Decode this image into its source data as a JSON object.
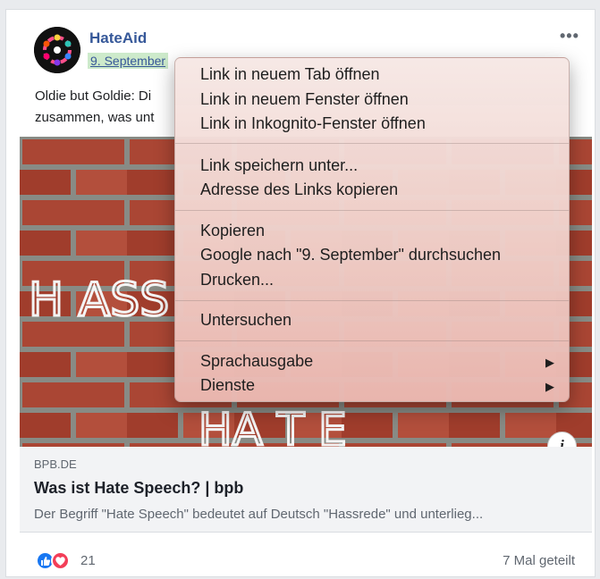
{
  "post": {
    "page_name": "HateAid",
    "date": "9. September",
    "text_line1": "Oldie but Goldie: Di",
    "text_line2": "zusammen, was unt",
    "more_label": "•••"
  },
  "link_preview": {
    "domain": "BPB.DE",
    "title": "Was ist Hate Speech? | bpb",
    "description": "Der Begriff \"Hate Speech\" bedeutet auf Deutsch \"Hassrede\" und unterlieg..."
  },
  "image": {
    "graffiti_1": "H ASS",
    "graffiti_2": "HA T E"
  },
  "info_icon_label": "i",
  "footer": {
    "reaction_count": "21",
    "shares": "7 Mal geteilt"
  },
  "context_menu": {
    "items": [
      "Link in neuem Tab öffnen",
      "Link in neuem Fenster öffnen",
      "Link in Inkognito-Fenster öffnen",
      "Link speichern unter...",
      "Adresse des Links kopieren",
      "Kopieren",
      "Google nach \"9. September\" durchsuchen",
      "Drucken...",
      "Untersuchen",
      "Sprachausgabe",
      "Dienste"
    ],
    "submenu_arrow": "▶"
  },
  "colors": {
    "brand_link": "#365899",
    "menu_tint": "#f0d0ca",
    "brick": "#b24a3a",
    "like": "#1877f2",
    "love": "#f33e58"
  }
}
